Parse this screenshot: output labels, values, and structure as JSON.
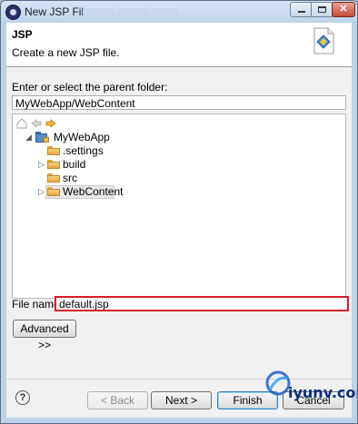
{
  "window": {
    "title": "New JSP File"
  },
  "header": {
    "title": "JSP",
    "description": "Create a new JSP file."
  },
  "folder": {
    "label": "Enter or select the parent folder:",
    "value": "MyWebApp/WebContent"
  },
  "tree": {
    "items": [
      {
        "label": "MyWebApp",
        "icon": "web-project-icon",
        "expanded": true
      },
      {
        "label": ".settings",
        "icon": "folder-icon"
      },
      {
        "label": "build",
        "icon": "folder-icon"
      },
      {
        "label": "src",
        "icon": "folder-icon"
      },
      {
        "label": "WebContent",
        "icon": "folder-icon",
        "selected": true
      }
    ]
  },
  "file_name": {
    "label": "File name:",
    "value": "default.jsp"
  },
  "buttons": {
    "advanced": "Advanced >>",
    "back": "< Back",
    "next": "Next >",
    "finish": "Finish",
    "cancel": "Cancel"
  },
  "watermark": {
    "text": "iyunv.com"
  },
  "colors": {
    "highlight_border": "#d91a2a",
    "folder": "#e6a845",
    "accent": "#3c7fb1"
  }
}
